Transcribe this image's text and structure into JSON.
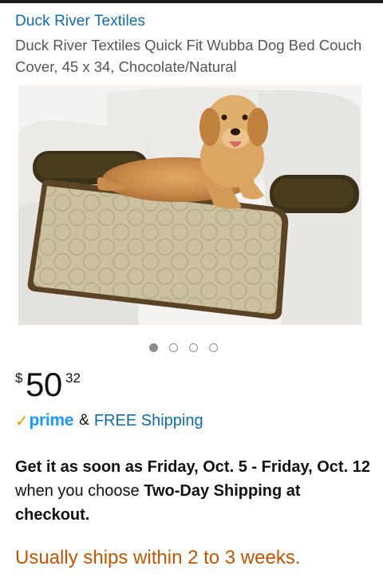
{
  "brand": {
    "name": "Duck River Textiles"
  },
  "product": {
    "title": "Duck River Textiles Quick Fit Wubba Dog Bed Couch Cover, 45 x 34, Chocolate/Natural",
    "image_count": 4,
    "active_image_index": 0
  },
  "price": {
    "currency": "$",
    "whole": "50",
    "fraction": "32"
  },
  "shipping": {
    "prime_label": "prime",
    "amp": "&",
    "free_label": "FREE Shipping"
  },
  "delivery": {
    "part1": "Get it as soon as Friday, Oct. 5 - Friday, Oct. 12",
    "part2": " when you choose ",
    "part3": "Two-Day Shipping at checkout."
  },
  "availability": {
    "text": "Usually ships within 2 to 3 weeks."
  },
  "colors": {
    "link": "#0f6cab",
    "prime_blue": "#1a98ff",
    "prime_check": "#f79400",
    "availability": "#c45500"
  }
}
